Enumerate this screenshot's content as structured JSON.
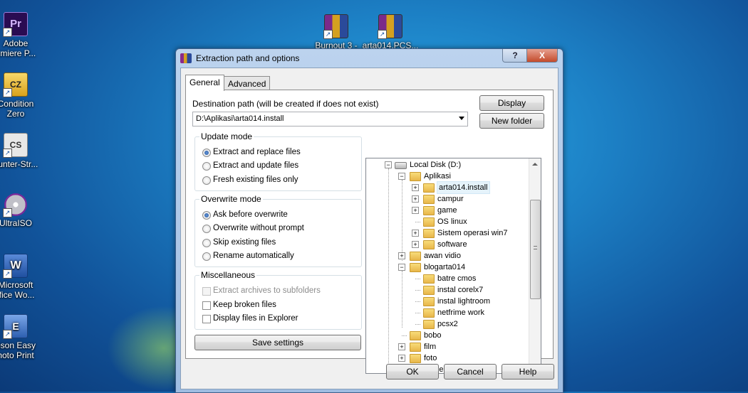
{
  "desktop": {
    "icons": [
      {
        "label": "Adobe",
        "label2": "emiere P...",
        "color": "#2a0c52",
        "glyph": "Pr"
      },
      {
        "label": "Condition",
        "label2": "Zero",
        "color": "#f4c430",
        "glyph": "CZ"
      },
      {
        "label": "ounter-Str...",
        "label2": "",
        "color": "#e8e8e8",
        "glyph": "CS"
      },
      {
        "label": "UltraISO",
        "label2": "",
        "color": "#c0c0c8",
        "glyph": "◎"
      },
      {
        "label": "Microsoft",
        "label2": "ffice Wo...",
        "color": "#2b5caa",
        "glyph": "W"
      },
      {
        "label": "pson Easy",
        "label2": "hoto Print",
        "color": "#3a6fc2",
        "glyph": "E"
      },
      {
        "label": "Burnout 3 -",
        "label2": "",
        "color": "#7a2a8a",
        "glyph": "R"
      },
      {
        "label": "arta014.PCS...",
        "label2": "",
        "color": "#7a2a8a",
        "glyph": "R"
      }
    ]
  },
  "dialog": {
    "title": "Extraction path and options",
    "help_btn": "?",
    "close_btn": "X",
    "tabs": [
      "General",
      "Advanced"
    ],
    "dest_label": "Destination path (will be created if does not exist)",
    "dest_value": "D:\\Aplikasi\\arta014.install",
    "display_btn": "Display",
    "new_folder_btn": "New folder",
    "update_mode": {
      "title": "Update mode",
      "options": [
        "Extract and replace files",
        "Extract and update files",
        "Fresh existing files only"
      ],
      "selected": 0
    },
    "overwrite_mode": {
      "title": "Overwrite mode",
      "options": [
        "Ask before overwrite",
        "Overwrite without prompt",
        "Skip existing files",
        "Rename automatically"
      ],
      "selected": 0
    },
    "misc": {
      "title": "Miscellaneous",
      "options": [
        "Extract archives to subfolders",
        "Keep broken files",
        "Display files in Explorer"
      ]
    },
    "save_settings_btn": "Save settings",
    "tree": {
      "root": "Local Disk (D:)",
      "items": [
        {
          "name": "Aplikasi"
        },
        {
          "name": "arta014.install"
        },
        {
          "name": "campur"
        },
        {
          "name": "game"
        },
        {
          "name": "OS linux"
        },
        {
          "name": "Sistem operasi win7"
        },
        {
          "name": "software"
        },
        {
          "name": "awan vidio"
        },
        {
          "name": "blogarta014"
        },
        {
          "name": "batre cmos"
        },
        {
          "name": "instal corelx7"
        },
        {
          "name": "instal lightroom"
        },
        {
          "name": "netfrime work"
        },
        {
          "name": "pcsx2"
        },
        {
          "name": "bobo"
        },
        {
          "name": "film"
        },
        {
          "name": "foto"
        },
        {
          "name": "game"
        }
      ]
    },
    "ok_btn": "OK",
    "cancel_btn": "Cancel",
    "help_button": "Help"
  }
}
